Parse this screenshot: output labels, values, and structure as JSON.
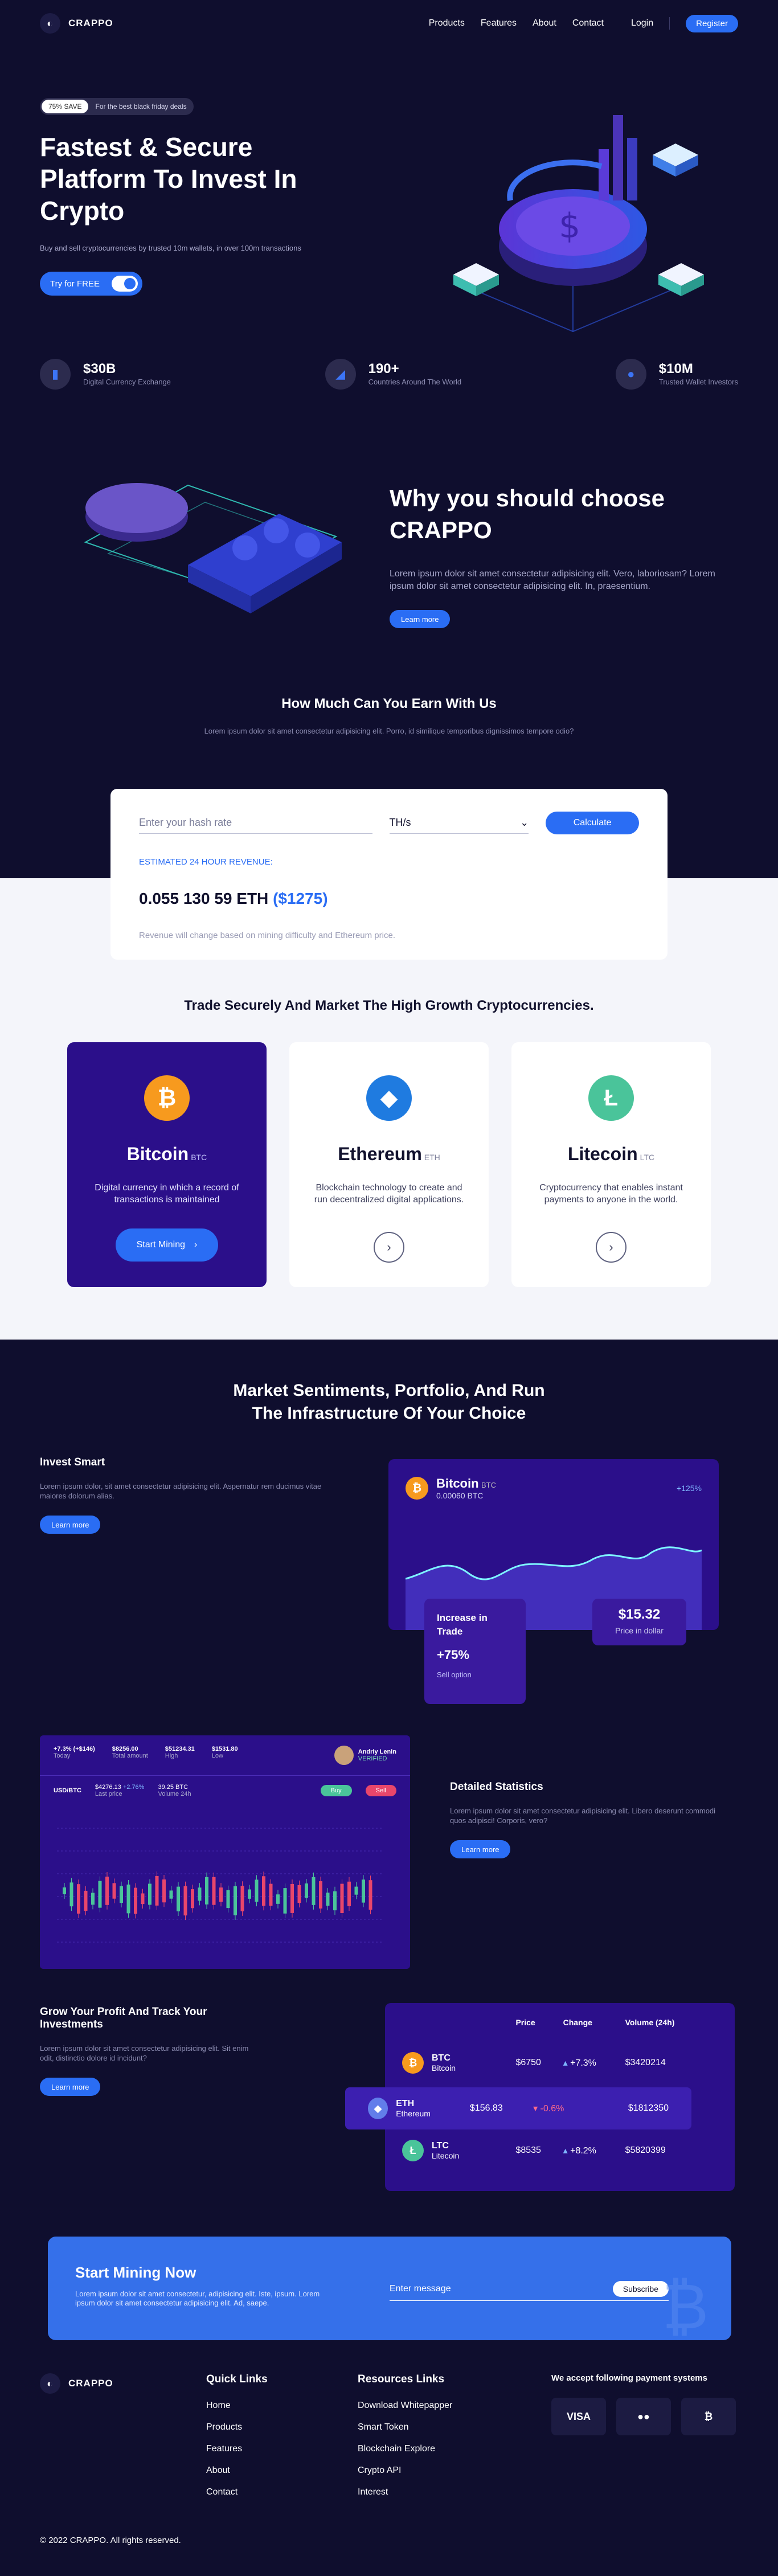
{
  "header": {
    "brand": "CRAPPO",
    "nav": [
      "Products",
      "Features",
      "About",
      "Contact"
    ],
    "login": "Login",
    "register": "Register"
  },
  "hero": {
    "badge_pill": "75% SAVE",
    "badge_text": "For the best black friday deals",
    "title": "Fastest & Secure Platform To Invest In Crypto",
    "subtitle": "Buy and sell cryptocurrencies by trusted 10m wallets, in over 100m transactions",
    "cta": "Try for FREE"
  },
  "stats": [
    {
      "value": "$30B",
      "label": "Digital Currency Exchange",
      "icon": "bar-chart-icon"
    },
    {
      "value": "190+",
      "label": "Countries Around The World",
      "icon": "globe-icon"
    },
    {
      "value": "$10M",
      "label": "Trusted Wallet Investors",
      "icon": "user-icon"
    }
  ],
  "why": {
    "title": "Why you should choose CRAPPO",
    "text": "Lorem ipsum dolor sit amet consectetur adipisicing elit. Vero, laboriosam? Lorem ipsum dolor sit amet consectetur adipisicing elit. In, praesentium.",
    "button": "Learn more"
  },
  "calc": {
    "title": "How Much Can You Earn With Us",
    "subtitle": "Lorem ipsum dolor sit amet consectetur adipisicing elit. Porro, id similique temporibus dignissimos tempore odio?",
    "hash_placeholder": "Enter your hash rate",
    "unit": "TH/s",
    "button": "Calculate",
    "est_label": "ESTIMATED 24 HOUR REVENUE:",
    "amount": "0.055 130 59 ETH",
    "amount_usd": "($1275)",
    "note": "Revenue will change based on mining difficulty and Ethereum price."
  },
  "trade": {
    "title": "Trade Securely And Market The High Growth Cryptocurrencies.",
    "cards": [
      {
        "name": "Bitcoin",
        "code": "BTC",
        "symbol": "₿",
        "desc": "Digital currency in which a record of transactions is maintained",
        "button": "Start Mining",
        "color": "#f79a1e"
      },
      {
        "name": "Ethereum",
        "code": "ETH",
        "symbol": "◆",
        "desc": "Blockchain technology to create and run decentralized digital applications.",
        "color": "#1f7be0"
      },
      {
        "name": "Litecoin",
        "code": "LTC",
        "symbol": "Ł",
        "desc": "Cryptocurrency that enables instant payments to anyone in the world.",
        "color": "#4ac49a"
      }
    ]
  },
  "market": {
    "title": "Market Sentiments, Portfolio, And Run The Infrastructure Of Your Choice",
    "invest": {
      "title": "Invest Smart",
      "text": "Lorem ipsum dolor, sit amet consectetur adipisicing elit. Aspernatur rem ducimus vitae maiores dolorum alias.",
      "button": "Learn more"
    },
    "btc_panel": {
      "name": "Bitcoin",
      "code": "BTC",
      "amount": "0.00060 BTC",
      "change": "+125%",
      "inc_title": "Increase in Trade",
      "inc_value": "+75%",
      "inc_sub": "Sell option",
      "price": "$15.32",
      "price_sub": "Price in dollar"
    },
    "stats": {
      "title": "Detailed Statistics",
      "text": "Lorem ipsum dolor sit amet consectetur adipisicing elit. Libero deserunt commodi quos adipisci! Corporis, vero?",
      "button": "Learn more"
    },
    "dash": {
      "change": "+7.3% (+$146)",
      "change_label": "Today",
      "values": [
        {
          "v": "$8256.00",
          "l": "Total amount"
        },
        {
          "v": "$51234.31",
          "l": "High"
        },
        {
          "v": "$1531.80",
          "l": "Low"
        }
      ],
      "user": "Andriy Lenin",
      "user_sub": "VERIFIED",
      "pair": "USD/BTC",
      "pair_v1": "$4276.13",
      "pair_c1": "+2.76%",
      "pair_l1": "Last price",
      "pair_v2": "39.25 BTC",
      "pair_l2": "Volume 24h",
      "buy": "Buy",
      "sell": "Sell"
    },
    "grow": {
      "title": "Grow Your Profit And Track Your Investments",
      "text": "Lorem ipsum dolor sit amet consectetur adipisicing elit. Sit enim odit, distinctio dolore id incidunt?",
      "button": "Learn more"
    },
    "table": {
      "headers": [
        "",
        "Price",
        "Change",
        "Volume (24h)"
      ],
      "rows": [
        {
          "code": "BTC",
          "name": "Bitcoin",
          "price": "$6750",
          "change": "+7.3%",
          "volume": "$3420214",
          "color": "#f79a1e",
          "up": true
        },
        {
          "code": "ETH",
          "name": "Ethereum",
          "price": "$156.83",
          "change": "-0.6%",
          "volume": "$1812350",
          "color": "#627eea",
          "up": false
        },
        {
          "code": "LTC",
          "name": "Litecoin",
          "price": "$8535",
          "change": "+8.2%",
          "volume": "$5820399",
          "color": "#4ac49a",
          "up": true
        }
      ]
    }
  },
  "cta": {
    "title": "Start Mining Now",
    "text": "Lorem ipsum dolor sit amet consectetur, adipisicing elit. Iste, ipsum. Lorem ipsum dolor sit amet consectetur adipisicing elit. Ad, saepe.",
    "placeholder": "Enter message",
    "button": "Subscribe"
  },
  "footer": {
    "brand": "CRAPPO",
    "quick_title": "Quick Links",
    "quick": [
      "Home",
      "Products",
      "Features",
      "About",
      "Contact"
    ],
    "res_title": "Resources Links",
    "res": [
      "Download Whitepapper",
      "Smart Token",
      "Blockchain Explore",
      "Crypto API",
      "Interest"
    ],
    "pay_title": "We accept following payment systems",
    "pay": [
      "VISA",
      "●●",
      "₿"
    ],
    "copy": "© 2022 CRAPPO. All rights reserved."
  }
}
